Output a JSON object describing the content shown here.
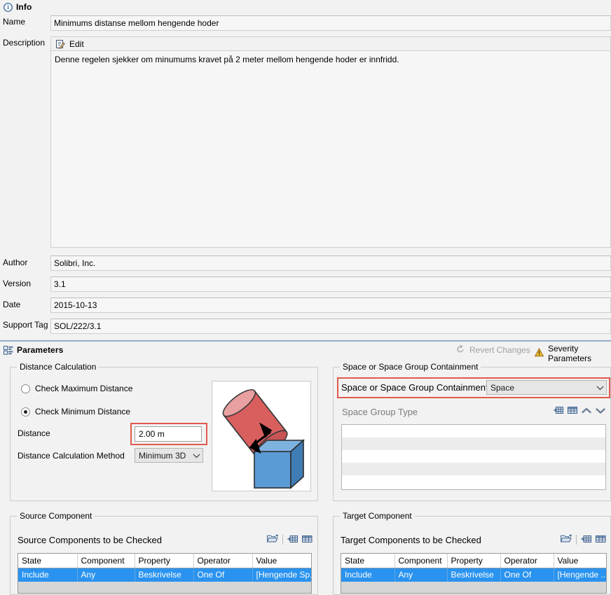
{
  "info": {
    "header": "Info",
    "header_icon": "info-circle-icon",
    "fields": {
      "name_label": "Name",
      "name_value": "Minimums distanse mellom hengende hoder",
      "description_label": "Description",
      "edit_label": "Edit",
      "edit_icon": "edit-pencil-icon",
      "description_value": "Denne regelen sjekker om minumums kravet på 2 meter mellom hengende hoder er innfridd.",
      "author_label": "Author",
      "author_value": "Solibri, Inc.",
      "version_label": "Version",
      "version_value": "3.1",
      "date_label": "Date",
      "date_value": "2015-10-13",
      "support_tag_label": "Support Tag",
      "support_tag_value": "SOL/222/3.1"
    }
  },
  "parameters": {
    "header": "Parameters",
    "header_icon": "parameters-list-icon",
    "revert_label": "Revert Changes",
    "revert_icon": "revert-arrow-icon",
    "severity_label": "Severity Parameters",
    "severity_icon": "warning-triangle-icon",
    "distance_calculation": {
      "title": "Distance Calculation",
      "radio_max": "Check Maximum Distance",
      "radio_min": "Check Minimum Distance",
      "radio_selected": "min",
      "distance_label": "Distance",
      "distance_value": "2.00 m",
      "method_label": "Distance Calculation Method",
      "method_value": "Minimum 3D",
      "illustration_icon": "cylinder-cube-distance-illustration"
    },
    "space_containment": {
      "title": "Space or Space Group Containment",
      "field_label": "Space or Space Group Containment",
      "field_value": "Space",
      "group_type_label": "Space Group Type",
      "toolbar_icons": [
        "add-row-icon",
        "table-icon",
        "move-up-icon",
        "move-down-icon"
      ],
      "list_rows": 5
    }
  },
  "source_component": {
    "group_title": "Source Component",
    "subtitle": "Source Components to be Checked",
    "toolbar_icons": [
      "open-folder-icon",
      "add-row-icon",
      "table-rows-icon"
    ],
    "columns": [
      "State",
      "Component",
      "Property",
      "Operator",
      "Value"
    ],
    "rows": [
      {
        "state": "Include",
        "component": "Any",
        "property": "Beskrivelse",
        "operator": "One Of",
        "value": "[Hengende Sp...",
        "selected": true
      }
    ]
  },
  "target_component": {
    "group_title": "Target Component",
    "subtitle": "Target Components to be Checked",
    "toolbar_icons": [
      "open-folder-icon",
      "add-row-icon",
      "table-rows-icon"
    ],
    "columns": [
      "State",
      "Component",
      "Property",
      "Operator",
      "Value"
    ],
    "rows": [
      {
        "state": "Include",
        "component": "Any",
        "property": "Beskrivelse",
        "operator": "One Of",
        "value": "[Hengende ...",
        "selected": true
      }
    ]
  },
  "colors": {
    "highlight_red": "#e05a4e",
    "selection_blue": "#2a93ef",
    "header_rule": "#9cb3cc",
    "background": "#f2f2f2",
    "cylinder_red": "#d95f5f",
    "cube_blue": "#5b9bd5"
  }
}
